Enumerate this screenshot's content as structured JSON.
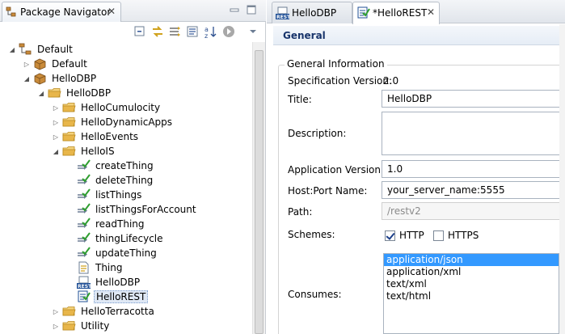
{
  "left_panel": {
    "tab_title": "Package Navigator",
    "tab_close": "✕",
    "tree": [
      {
        "label": "Default",
        "indent": 0,
        "twisty": "expanded",
        "icon": "package-root-icon"
      },
      {
        "label": "Default",
        "indent": 1,
        "twisty": "collapsed",
        "icon": "package-icon"
      },
      {
        "label": "HelloDBP",
        "indent": 1,
        "twisty": "expanded",
        "icon": "package-icon"
      },
      {
        "label": "HelloDBP",
        "indent": 2,
        "twisty": "expanded",
        "icon": "folder-icon"
      },
      {
        "label": "HelloCumulocity",
        "indent": 3,
        "twisty": "collapsed",
        "icon": "folder-icon"
      },
      {
        "label": "HelloDynamicApps",
        "indent": 3,
        "twisty": "collapsed",
        "icon": "folder-icon"
      },
      {
        "label": "HelloEvents",
        "indent": 3,
        "twisty": "collapsed",
        "icon": "folder-icon"
      },
      {
        "label": "HelloIS",
        "indent": 3,
        "twisty": "expanded",
        "icon": "folder-icon"
      },
      {
        "label": "createThing",
        "indent": 4,
        "twisty": "none",
        "icon": "service-icon"
      },
      {
        "label": "deleteThing",
        "indent": 4,
        "twisty": "none",
        "icon": "service-icon"
      },
      {
        "label": "listThings",
        "indent": 4,
        "twisty": "none",
        "icon": "service-icon"
      },
      {
        "label": "listThingsForAccount",
        "indent": 4,
        "twisty": "none",
        "icon": "service-icon"
      },
      {
        "label": "readThing",
        "indent": 4,
        "twisty": "none",
        "icon": "service-icon"
      },
      {
        "label": "thingLifecycle",
        "indent": 4,
        "twisty": "none",
        "icon": "service-icon"
      },
      {
        "label": "updateThing",
        "indent": 4,
        "twisty": "none",
        "icon": "service-icon"
      },
      {
        "label": "Thing",
        "indent": 4,
        "twisty": "none",
        "icon": "document-type-icon"
      },
      {
        "label": "HelloDBP",
        "indent": 4,
        "twisty": "none",
        "icon": "rest-descriptor-icon"
      },
      {
        "label": "HelloREST",
        "indent": 4,
        "twisty": "none",
        "icon": "rest-resource-icon",
        "selected": true
      },
      {
        "label": "HelloTerracotta",
        "indent": 3,
        "twisty": "collapsed",
        "icon": "folder-icon"
      },
      {
        "label": "Utility",
        "indent": 3,
        "twisty": "collapsed",
        "icon": "folder-icon"
      }
    ]
  },
  "editor": {
    "tabs": [
      {
        "label": "HelloDBP",
        "active": false
      },
      {
        "label": "*HelloREST",
        "active": true
      }
    ],
    "tab_close": "✕",
    "section_title": "General",
    "group_title": "General Information",
    "spec_version_label": "Specification Version:",
    "spec_version_value": "2.0",
    "title_label": "Title:",
    "title_value": "HelloDBP",
    "description_label": "Description:",
    "app_version_label": "Application Version:",
    "app_version_value": "1.0",
    "hostport_label": "Host:Port Name:",
    "hostport_value": "your_server_name:5555",
    "path_label": "Path:",
    "path_value": "/restv2",
    "schemes_label": "Schemes:",
    "schemes": [
      {
        "label": "HTTP",
        "checked": true
      },
      {
        "label": "HTTPS",
        "checked": false
      }
    ],
    "consumes_label": "Consumes:",
    "consumes_options": [
      {
        "label": "application/json",
        "selected": true
      },
      {
        "label": "application/xml",
        "selected": false
      },
      {
        "label": "text/xml",
        "selected": false
      },
      {
        "label": "text/html",
        "selected": false
      }
    ]
  },
  "colors": {
    "section_title": "#18346b",
    "selection": "#3399ff",
    "folder": "#e8b64a",
    "package": "#b5773c",
    "service_check": "#2f9e2f"
  }
}
